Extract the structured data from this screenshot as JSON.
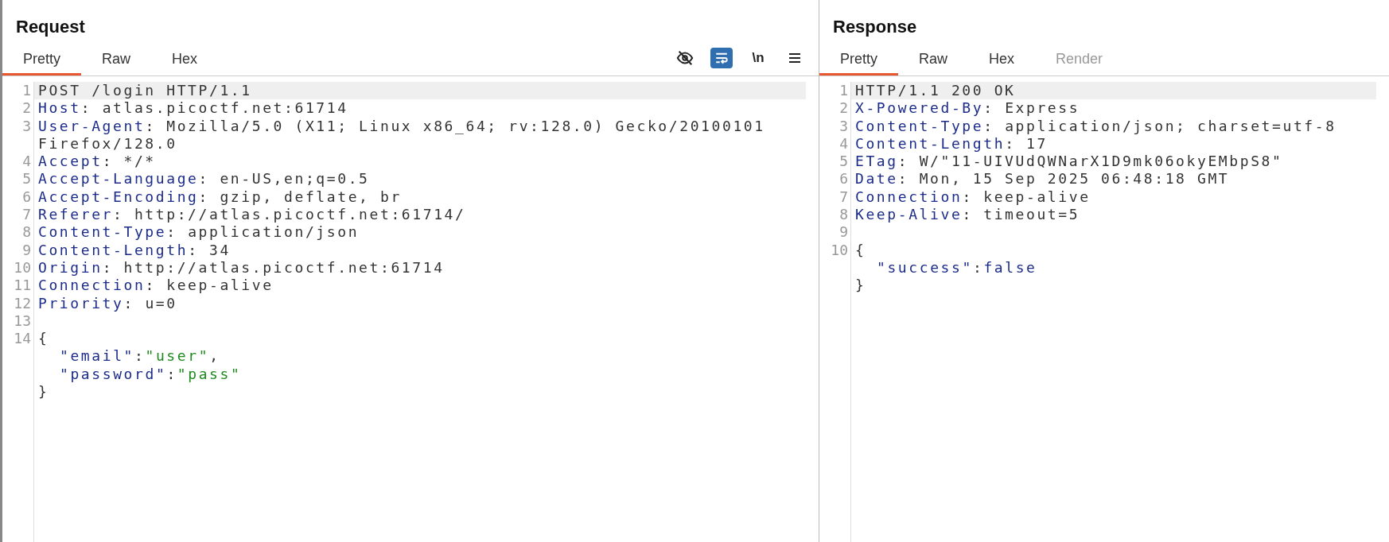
{
  "panels": [
    {
      "title": "Request",
      "tabs": [
        {
          "label": "Pretty",
          "selected": true,
          "disabled": false
        },
        {
          "label": "Raw",
          "selected": false,
          "disabled": false
        },
        {
          "label": "Hex",
          "selected": false,
          "disabled": false
        }
      ],
      "toolbar": [
        {
          "kind": "hide",
          "on": false
        },
        {
          "kind": "wrap",
          "on": true
        },
        {
          "kind": "newlines",
          "label": "\\n",
          "on": false
        },
        {
          "kind": "menu",
          "on": false
        }
      ],
      "lines": [
        {
          "number": "1",
          "kind": "plain",
          "text": "POST /login HTTP/1.1",
          "highlighted": true
        },
        {
          "number": "2",
          "kind": "header",
          "name": "Host",
          "separator": ":",
          "value": "atlas.picoctf.net:61714",
          "highlighted": false
        },
        {
          "number": "3",
          "kind": "header",
          "name": "User-Agent",
          "separator": ":",
          "value": "Mozilla/5.0 (X11; Linux x86_64; rv:128.0) Gecko/20100101 Firefox/128.0",
          "highlighted": false
        },
        {
          "number": "4",
          "kind": "header",
          "name": "Accept",
          "separator": ":",
          "value": "*/*",
          "highlighted": false
        },
        {
          "number": "5",
          "kind": "header",
          "name": "Accept-Language",
          "separator": ":",
          "value": "en-US,en;q=0.5",
          "highlighted": false
        },
        {
          "number": "6",
          "kind": "header",
          "name": "Accept-Encoding",
          "separator": ":",
          "value": "gzip, deflate, br",
          "highlighted": false
        },
        {
          "number": "7",
          "kind": "header",
          "name": "Referer",
          "separator": ":",
          "value": "http://atlas.picoctf.net:61714/",
          "highlighted": false
        },
        {
          "number": "8",
          "kind": "header",
          "name": "Content-Type",
          "separator": ":",
          "value": "application/json",
          "highlighted": false
        },
        {
          "number": "9",
          "kind": "header",
          "name": "Content-Length",
          "separator": ":",
          "value": "34",
          "highlighted": false
        },
        {
          "number": "10",
          "kind": "header",
          "name": "Origin",
          "separator": ":",
          "value": "http://atlas.picoctf.net:61714",
          "highlighted": false
        },
        {
          "number": "11",
          "kind": "header",
          "name": "Connection",
          "separator": ":",
          "value": "keep-alive",
          "highlighted": false
        },
        {
          "number": "12",
          "kind": "header",
          "name": "Priority",
          "separator": ":",
          "value": "u=0",
          "highlighted": false
        },
        {
          "number": "13",
          "kind": "blank",
          "highlighted": false
        },
        {
          "number": "14",
          "kind": "plain",
          "text": "{",
          "highlighted": false
        },
        {
          "kind": "pair",
          "key": "\"email\"",
          "separator": ":",
          "value": "\"user\"",
          "color": "#1e8a1e",
          "trail": ",",
          "highlighted": false
        },
        {
          "kind": "pair",
          "key": "\"password\"",
          "separator": ":",
          "value": "\"pass\"",
          "color": "#1e8a1e",
          "highlighted": false
        },
        {
          "kind": "plain",
          "text": "}",
          "highlighted": false
        }
      ]
    },
    {
      "title": "Response",
      "tabs": [
        {
          "label": "Pretty",
          "selected": true,
          "disabled": false
        },
        {
          "label": "Raw",
          "selected": false,
          "disabled": false
        },
        {
          "label": "Hex",
          "selected": false,
          "disabled": false
        },
        {
          "label": "Render",
          "selected": false,
          "disabled": true
        }
      ],
      "lines": [
        {
          "number": "1",
          "kind": "plain",
          "text": "HTTP/1.1 200 OK",
          "highlighted": true
        },
        {
          "number": "2",
          "kind": "header",
          "name": "X-Powered-By",
          "separator": ":",
          "value": "Express",
          "highlighted": false
        },
        {
          "number": "3",
          "kind": "header",
          "name": "Content-Type",
          "separator": ":",
          "value": "application/json; charset=utf-8",
          "highlighted": false
        },
        {
          "number": "4",
          "kind": "header",
          "name": "Content-Length",
          "separator": ":",
          "value": "17",
          "highlighted": false
        },
        {
          "number": "5",
          "kind": "header",
          "name": "ETag",
          "separator": ":",
          "value": "W/\"11-UIVUdQWNarX1D9mk06okyEMbpS8\"",
          "highlighted": false
        },
        {
          "number": "6",
          "kind": "header",
          "name": "Date",
          "separator": ":",
          "value": "Mon, 15 Sep 2025 06:48:18 GMT",
          "highlighted": false
        },
        {
          "number": "7",
          "kind": "header",
          "name": "Connection",
          "separator": ":",
          "value": "keep-alive",
          "highlighted": false
        },
        {
          "number": "8",
          "kind": "header",
          "name": "Keep-Alive",
          "separator": ":",
          "value": "timeout=5",
          "highlighted": false
        },
        {
          "number": "9",
          "kind": "blank",
          "highlighted": false
        },
        {
          "number": "10",
          "kind": "plain",
          "text": "{",
          "highlighted": false
        },
        {
          "kind": "pair",
          "key": "\"success\"",
          "separator": ":",
          "value": "false",
          "color": "#1c2c8a",
          "highlighted": false
        },
        {
          "kind": "plain",
          "text": "}",
          "highlighted": false
        }
      ]
    }
  ]
}
